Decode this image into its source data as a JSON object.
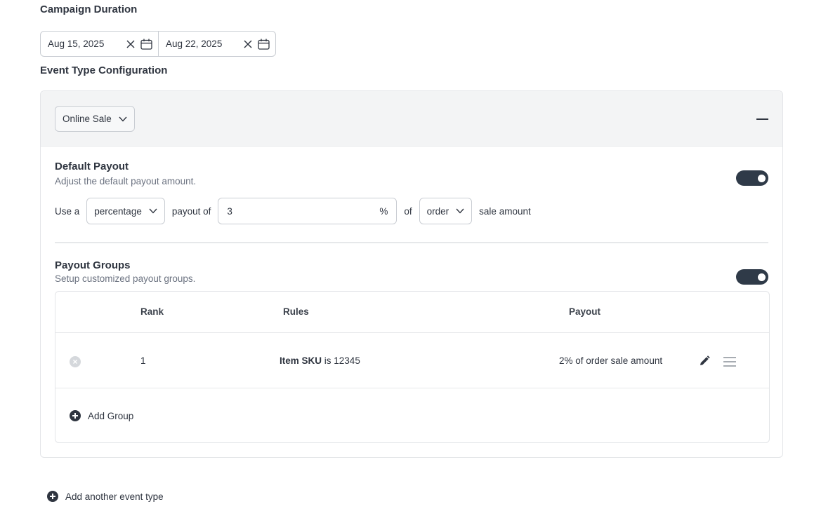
{
  "campaign": {
    "duration_title": "Campaign Duration",
    "start_date": "Aug 15, 2025",
    "end_date": "Aug 22, 2025"
  },
  "event_config": {
    "title": "Event Type Configuration",
    "event_type": "Online Sale"
  },
  "default_payout": {
    "title": "Default Payout",
    "description": "Adjust the default payout amount.",
    "enabled": true,
    "sentence": {
      "use_a": "Use a",
      "type": "percentage",
      "payout_of": "payout of",
      "amount": "3",
      "unit": "%",
      "of": "of",
      "basis": "order",
      "suffix": "sale amount"
    }
  },
  "payout_groups": {
    "title": "Payout Groups",
    "description": "Setup customized payout groups.",
    "enabled": true,
    "columns": {
      "rank": "Rank",
      "rules": "Rules",
      "payout": "Payout"
    },
    "rows": [
      {
        "rank": "1",
        "rule_field": "Item SKU",
        "rule_text": "is 12345",
        "payout": "2% of order sale amount"
      }
    ],
    "add_group_label": "Add Group"
  },
  "add_event_type_label": "Add another event type",
  "icons": {
    "clear": "close-icon",
    "calendar": "calendar-icon",
    "chevron": "chevron-down-icon",
    "edit": "pencil-icon",
    "drag": "drag-handle-icon",
    "remove": "remove-circle-icon",
    "add": "plus-circle-icon"
  }
}
